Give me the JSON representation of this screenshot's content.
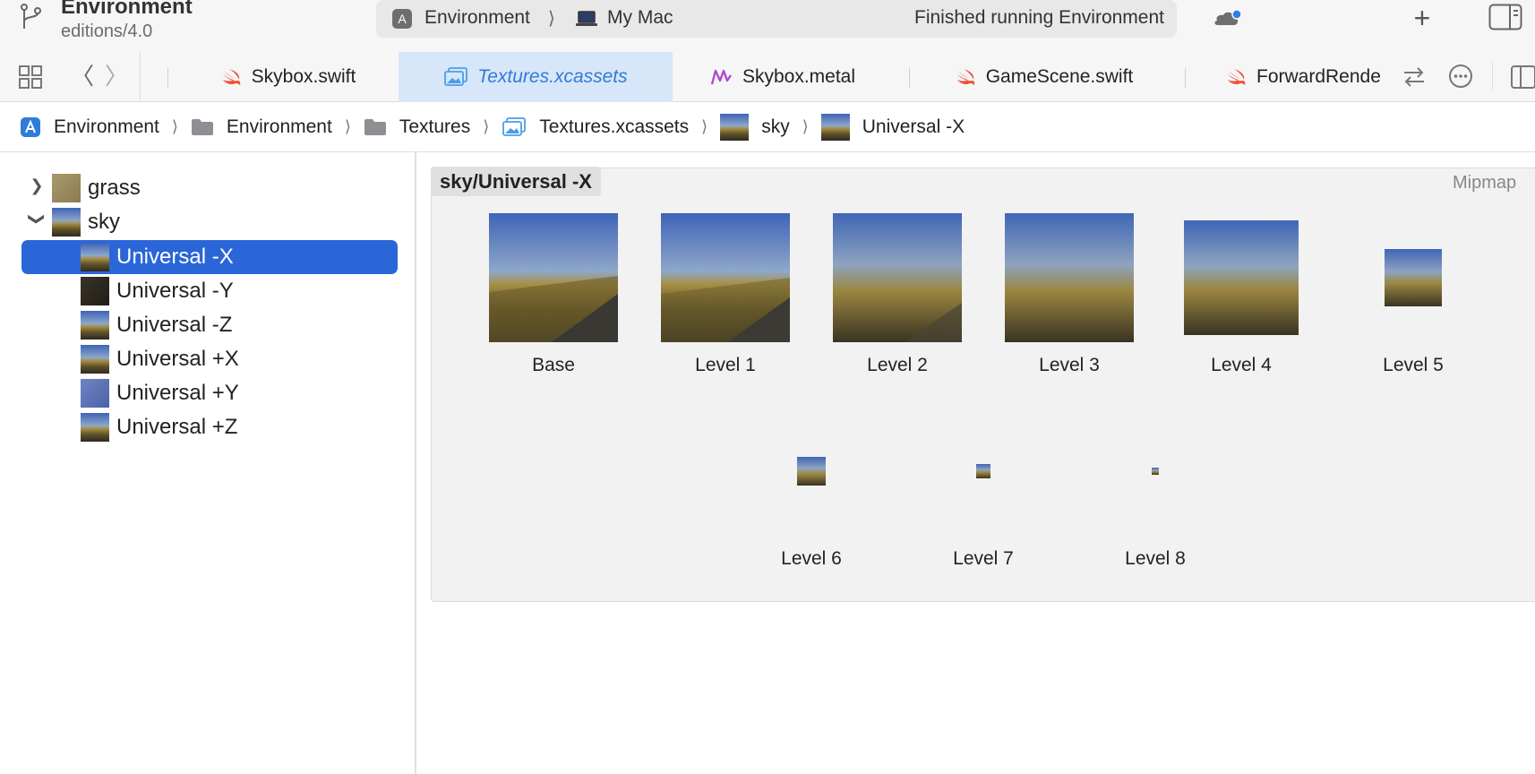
{
  "toolbar": {
    "project_name": "Environment",
    "branch": "editions/4.0",
    "scheme": "Environment",
    "destination": "My Mac",
    "status": "Finished running Environment"
  },
  "tabs": [
    {
      "label": "Skybox.swift",
      "icon": "swift-icon",
      "active": false
    },
    {
      "label": "Textures.xcassets",
      "icon": "asset-catalog-icon",
      "active": true
    },
    {
      "label": "Skybox.metal",
      "icon": "metal-icon",
      "active": false
    },
    {
      "label": "GameScene.swift",
      "icon": "swift-icon",
      "active": false
    },
    {
      "label": "ForwardRende",
      "icon": "swift-icon",
      "active": false
    }
  ],
  "breadcrumbs": [
    {
      "label": "Environment",
      "icon": "app-project-icon"
    },
    {
      "label": "Environment",
      "icon": "folder-icon"
    },
    {
      "label": "Textures",
      "icon": "folder-icon"
    },
    {
      "label": "Textures.xcassets",
      "icon": "asset-catalog-icon"
    },
    {
      "label": "sky",
      "icon": "sky-thumbnail"
    },
    {
      "label": "Universal -X",
      "icon": "sky-thumbnail"
    }
  ],
  "sidebar": {
    "items": [
      {
        "label": "grass",
        "expanded": false
      },
      {
        "label": "sky",
        "expanded": true
      },
      {
        "label": "Universal -X",
        "selected": true
      },
      {
        "label": "Universal -Y"
      },
      {
        "label": "Universal -Z"
      },
      {
        "label": "Universal +X"
      },
      {
        "label": "Universal +Y"
      },
      {
        "label": "Universal +Z"
      }
    ]
  },
  "editor": {
    "asset_title": "sky/Universal -X",
    "mode_label": "Mipmap",
    "levels": [
      "Base",
      "Level 1",
      "Level 2",
      "Level 3",
      "Level 4",
      "Level 5",
      "Level 6",
      "Level 7",
      "Level 8"
    ]
  },
  "colors": {
    "selection": "#2b66d9",
    "active_tab_bg": "#d7e6f8",
    "active_tab_text": "#2f7bd8",
    "swift_orange": "#f05138",
    "metal_purple": "#b04ad0"
  }
}
